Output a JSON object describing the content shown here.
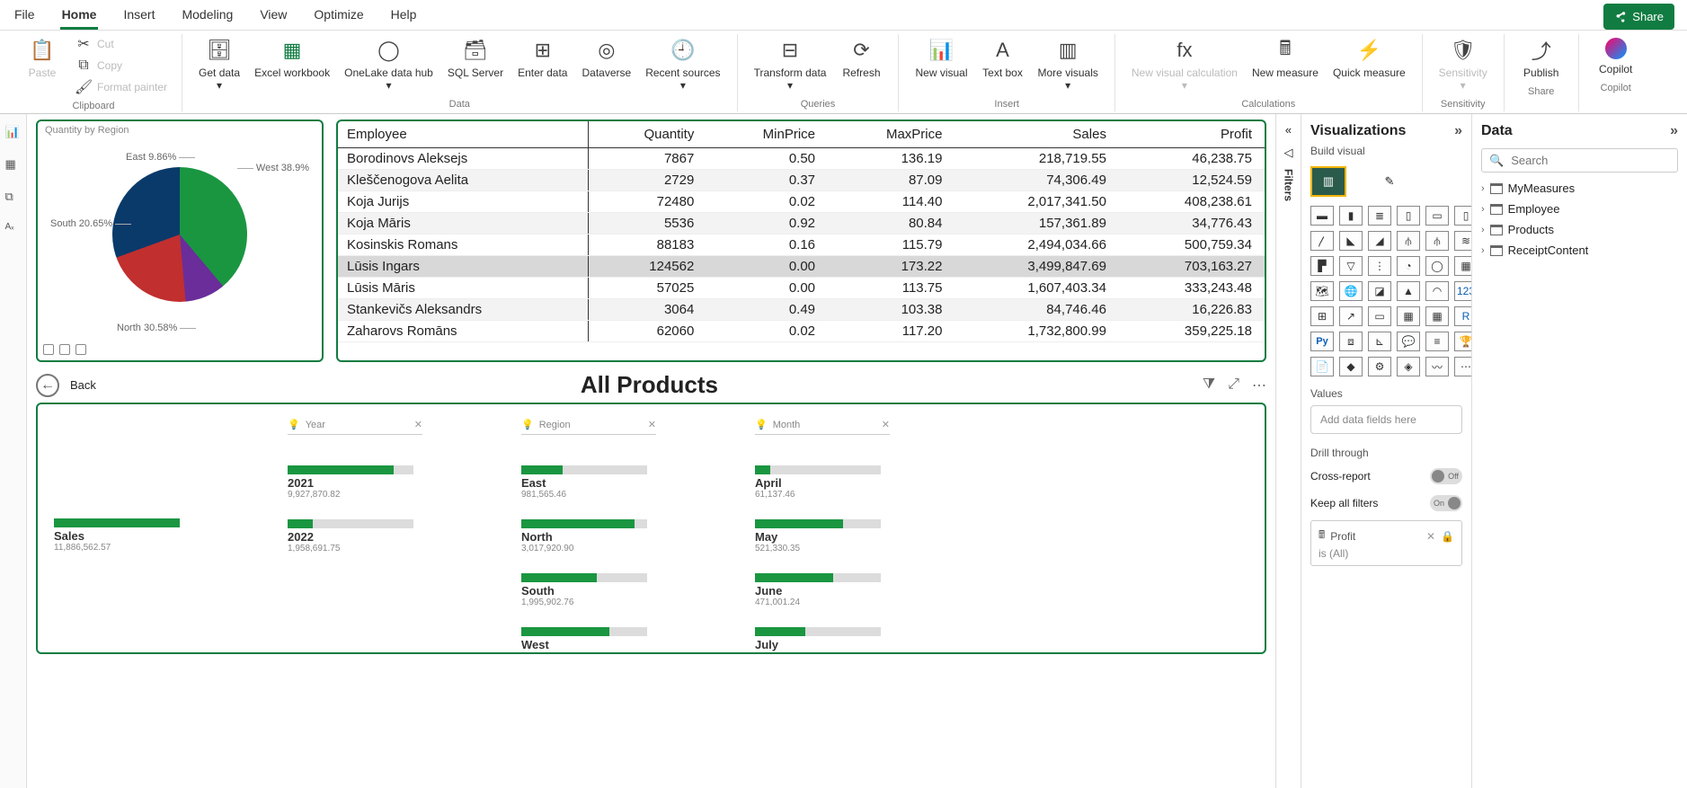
{
  "menu_tabs": [
    "File",
    "Home",
    "Insert",
    "Modeling",
    "View",
    "Optimize",
    "Help"
  ],
  "active_tab": "Home",
  "share_label": "Share",
  "ribbon": {
    "clipboard": {
      "paste": "Paste",
      "cut": "Cut",
      "copy": "Copy",
      "format_painter": "Format painter",
      "group": "Clipboard"
    },
    "data": {
      "get_data": "Get data",
      "excel": "Excel workbook",
      "onelake": "OneLake data hub",
      "sql": "SQL Server",
      "enter": "Enter data",
      "dataverse": "Dataverse",
      "recent": "Recent sources",
      "group": "Data"
    },
    "queries": {
      "transform": "Transform data",
      "refresh": "Refresh",
      "group": "Queries"
    },
    "insert": {
      "new_visual": "New visual",
      "text_box": "Text box",
      "more": "More visuals",
      "group": "Insert"
    },
    "calculations": {
      "new_visual_calc": "New visual calculation",
      "new_measure": "New measure",
      "quick_measure": "Quick measure",
      "group": "Calculations"
    },
    "sensitivity": {
      "sensitivity": "Sensitivity",
      "group": "Sensitivity"
    },
    "share": {
      "publish": "Publish",
      "group": "Share"
    },
    "copilot": {
      "copilot": "Copilot",
      "group": "Copilot"
    }
  },
  "pie": {
    "title": "Quantity by Region",
    "labels": {
      "west": "West 38.9%",
      "east": "East 9.86%",
      "south": "South 20.65%",
      "north": "North 30.58%"
    }
  },
  "emp_table": {
    "headers": [
      "Employee",
      "Quantity",
      "MinPrice",
      "MaxPrice",
      "Sales",
      "Profit"
    ],
    "rows": [
      {
        "emp": "Borodinovs Aleksejs",
        "qty": "7867",
        "min": "0.50",
        "max": "136.19",
        "sales": "218,719.55",
        "profit": "46,238.75"
      },
      {
        "emp": "Kleščenogova Aelita",
        "qty": "2729",
        "min": "0.37",
        "max": "87.09",
        "sales": "74,306.49",
        "profit": "12,524.59"
      },
      {
        "emp": "Koja Jurijs",
        "qty": "72480",
        "min": "0.02",
        "max": "114.40",
        "sales": "2,017,341.50",
        "profit": "408,238.61"
      },
      {
        "emp": "Koja Māris",
        "qty": "5536",
        "min": "0.92",
        "max": "80.84",
        "sales": "157,361.89",
        "profit": "34,776.43"
      },
      {
        "emp": "Kosinskis Romans",
        "qty": "88183",
        "min": "0.16",
        "max": "115.79",
        "sales": "2,494,034.66",
        "profit": "500,759.34"
      },
      {
        "emp": "Lūsis Ingars",
        "qty": "124562",
        "min": "0.00",
        "max": "173.22",
        "sales": "3,499,847.69",
        "profit": "703,163.27",
        "sel": true
      },
      {
        "emp": "Lūsis Māris",
        "qty": "57025",
        "min": "0.00",
        "max": "113.75",
        "sales": "1,607,403.34",
        "profit": "333,243.48"
      },
      {
        "emp": "Stankevičs Aleksandrs",
        "qty": "3064",
        "min": "0.49",
        "max": "103.38",
        "sales": "84,746.46",
        "profit": "16,226.83"
      },
      {
        "emp": "Zaharovs Romāns",
        "qty": "62060",
        "min": "0.02",
        "max": "117.20",
        "sales": "1,732,800.99",
        "profit": "359,225.18"
      }
    ]
  },
  "back_label": "Back",
  "all_products": "All Products",
  "decomp": {
    "columns": [
      {
        "head": "",
        "nodes": [
          {
            "lbl": "Sales",
            "val": "11,886,562.57",
            "fill": 100,
            "root": true
          }
        ]
      },
      {
        "head": "Year",
        "close": true,
        "nodes": [
          {
            "lbl": "2021",
            "val": "9,927,870.82",
            "fill": 84,
            "bold": true
          },
          {
            "lbl": "2022",
            "val": "1,958,691.75",
            "fill": 20
          }
        ]
      },
      {
        "head": "Region",
        "close": true,
        "nodes": [
          {
            "lbl": "East",
            "val": "981,565.46",
            "fill": 33
          },
          {
            "lbl": "North",
            "val": "3,017,920.90",
            "fill": 90
          },
          {
            "lbl": "South",
            "val": "1,995,902.76",
            "fill": 60
          },
          {
            "lbl": "West",
            "val": "",
            "fill": 70,
            "bold": true
          }
        ]
      },
      {
        "head": "Month",
        "close": true,
        "nodes": [
          {
            "lbl": "April",
            "val": "61,137.46",
            "fill": 12,
            "bold": true
          },
          {
            "lbl": "May",
            "val": "521,330.35",
            "fill": 70
          },
          {
            "lbl": "June",
            "val": "471,001.24",
            "fill": 62
          },
          {
            "lbl": "July",
            "val": "",
            "fill": 40
          }
        ]
      }
    ],
    "selected": {
      "year": "2021",
      "region": "West"
    }
  },
  "filters_label": "Filters",
  "viz_pane": {
    "title": "Visualizations",
    "subtitle": "Build visual",
    "values": "Values",
    "values_placeholder": "Add data fields here",
    "drill": "Drill through",
    "cross": "Cross-report",
    "cross_state": "Off",
    "keep": "Keep all filters",
    "keep_state": "On",
    "drill_field": "Profit",
    "drill_cond": "is (All)"
  },
  "data_pane": {
    "title": "Data",
    "search_placeholder": "Search",
    "tables": [
      "MyMeasures",
      "Employee",
      "Products",
      "ReceiptContent"
    ]
  },
  "chart_data": {
    "pie": {
      "type": "pie",
      "title": "Quantity by Region",
      "series": [
        {
          "name": "Quantity",
          "categories": [
            "West",
            "North",
            "South",
            "East"
          ],
          "values": [
            38.9,
            30.58,
            20.65,
            9.86
          ]
        }
      ]
    },
    "decomposition": {
      "type": "decomposition-tree",
      "root": {
        "name": "Sales",
        "value": 11886562.57
      },
      "levels": [
        {
          "field": "Year",
          "items": [
            {
              "name": "2021",
              "value": 9927870.82
            },
            {
              "name": "2022",
              "value": 1958691.75
            }
          ]
        },
        {
          "field": "Region",
          "items": [
            {
              "name": "East",
              "value": 981565.46
            },
            {
              "name": "North",
              "value": 3017920.9
            },
            {
              "name": "South",
              "value": 1995902.76
            },
            {
              "name": "West",
              "value": null
            }
          ]
        },
        {
          "field": "Month",
          "items": [
            {
              "name": "April",
              "value": 61137.46
            },
            {
              "name": "May",
              "value": 521330.35
            },
            {
              "name": "June",
              "value": 471001.24
            },
            {
              "name": "July",
              "value": null
            }
          ]
        }
      ]
    }
  }
}
